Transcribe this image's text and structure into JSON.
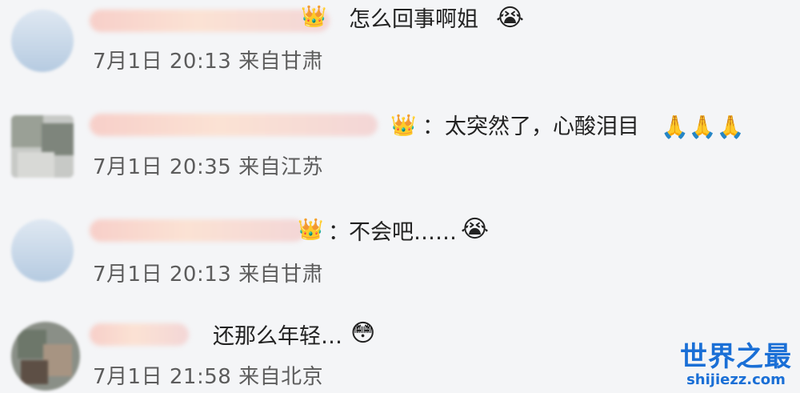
{
  "comments": [
    {
      "text": "怎么回事啊姐",
      "emoji": "😭",
      "date": "7月1日",
      "time": "20:13",
      "source": "来自甘肃",
      "badge": "👑"
    },
    {
      "text": "太突然了，心酸泪目",
      "emoji": "🙏🙏🙏",
      "date": "7月1日",
      "time": "20:35",
      "source": "来自江苏",
      "badge": "👑",
      "colon": "："
    },
    {
      "text": "不会吧……",
      "emoji": "😭",
      "date": "7月1日",
      "time": "20:13",
      "source": "来自甘肃",
      "badge": "👑",
      "colon": "："
    },
    {
      "text": "还那么年轻…",
      "emoji": "😳",
      "date": "7月1日",
      "time": "21:58",
      "source": "来自北京"
    }
  ],
  "watermark": {
    "main": "世界之最",
    "sub": "shijiezz.com"
  }
}
